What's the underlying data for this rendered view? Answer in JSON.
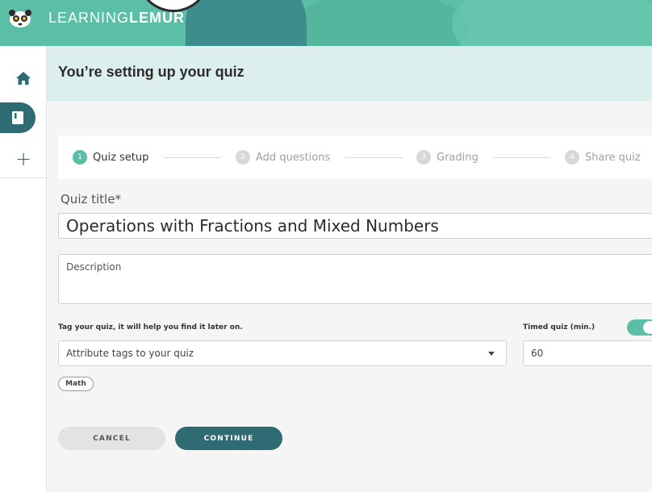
{
  "brand": {
    "light": "LEARNING",
    "bold": "LEMUR"
  },
  "page": {
    "title": "You’re setting up your quiz"
  },
  "steps": [
    {
      "num": "1",
      "label": "Quiz setup",
      "active": true
    },
    {
      "num": "2",
      "label": "Add questions",
      "active": false
    },
    {
      "num": "3",
      "label": "Grading",
      "active": false
    },
    {
      "num": "4",
      "label": "Share quiz",
      "active": false
    }
  ],
  "form": {
    "quiz_title_label": "Quiz title*",
    "quiz_title_value": "Operations with Fractions and Mixed Numbers",
    "description_placeholder": "Description",
    "tags_label": "Tag your quiz, it will help you find it later on.",
    "tags_placeholder": "Attribute tags to your quiz",
    "tag_chip": "Math",
    "timed_label": "Timed quiz (min.)",
    "timed_value": "60",
    "timed_enabled": true
  },
  "buttons": {
    "cancel": "CANCEL",
    "continue": "CONTINUE"
  },
  "sidebar": {
    "plus": "+"
  },
  "colors": {
    "accent": "#5bbfa6",
    "primary": "#2e6b73",
    "title_bg": "#dcefed"
  }
}
